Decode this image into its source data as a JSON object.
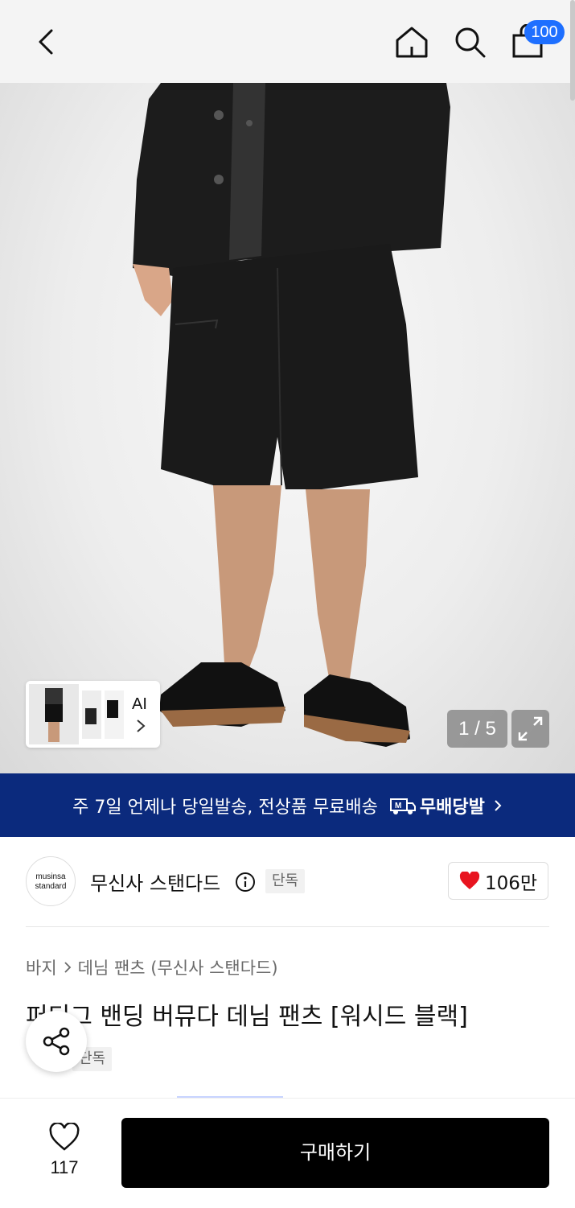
{
  "header": {
    "cart_count": "100",
    "icons": [
      "chevron-left-icon",
      "home-icon",
      "search-icon",
      "shopping-bag-icon"
    ]
  },
  "gallery": {
    "counter": "1 / 5",
    "ai_label": "AI"
  },
  "banner": {
    "text": "주 7일 언제나 당일발송, 전상품 무료배송",
    "brand": "무배당발"
  },
  "brand": {
    "logo_line1": "musinsa",
    "logo_line2": "standard",
    "name": "무신사 스탠다드",
    "tag": "단독",
    "likes": "106만"
  },
  "product": {
    "breadcrumb": [
      "바지",
      "데님 팬츠 (무신사 스탠다드)"
    ],
    "title": "퍼티그 밴딩 버뮤다 데님 팬츠 [워시드 블랙]",
    "tag": "단독"
  },
  "bottom": {
    "wish_count": "117",
    "buy_label": "구매하기"
  },
  "colors": {
    "banner_bg": "#0b2a7d",
    "badge_bg": "#1e6fff",
    "heart": "#e8141f"
  }
}
